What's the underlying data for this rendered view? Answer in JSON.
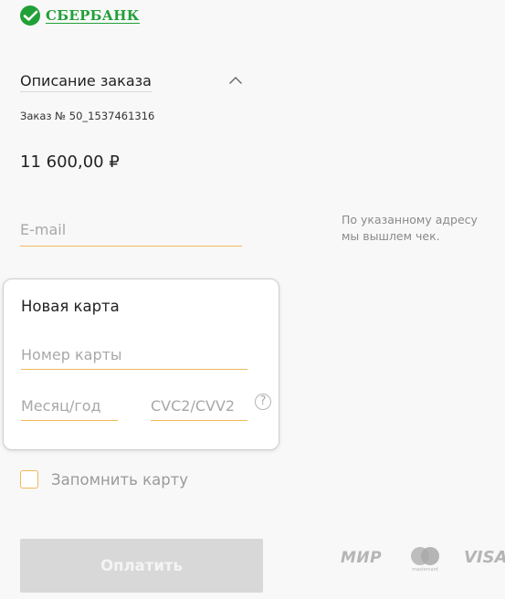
{
  "brand": {
    "name": "СБЕРБАНК",
    "color": "#21a038",
    "icon": "sberbank-logo-icon"
  },
  "order": {
    "title": "Описание заказа",
    "number": "Заказ № 50_1537461316",
    "amount": "11 600,00 ₽",
    "toggle_icon": "chevron-up-icon"
  },
  "email": {
    "placeholder": "E-mail",
    "value": "",
    "hint": "По указанному адресу мы вышлем чек."
  },
  "card": {
    "title": "Новая карта",
    "number_placeholder": "Номер карты",
    "expiry_placeholder": "Месяц/год",
    "cvc_placeholder": "CVC2/CVV2",
    "help_symbol": "?"
  },
  "remember": {
    "label": "Запомнить карту",
    "checked": false
  },
  "pay_button": {
    "label": "Оплатить",
    "enabled": false
  },
  "payment_systems": {
    "mir": "МИР",
    "mastercard": "mastercard",
    "visa": "VISA"
  },
  "colors": {
    "accent": "#f0b85a",
    "brand_green": "#21a038",
    "button_disabled": "#d8d8d8"
  }
}
